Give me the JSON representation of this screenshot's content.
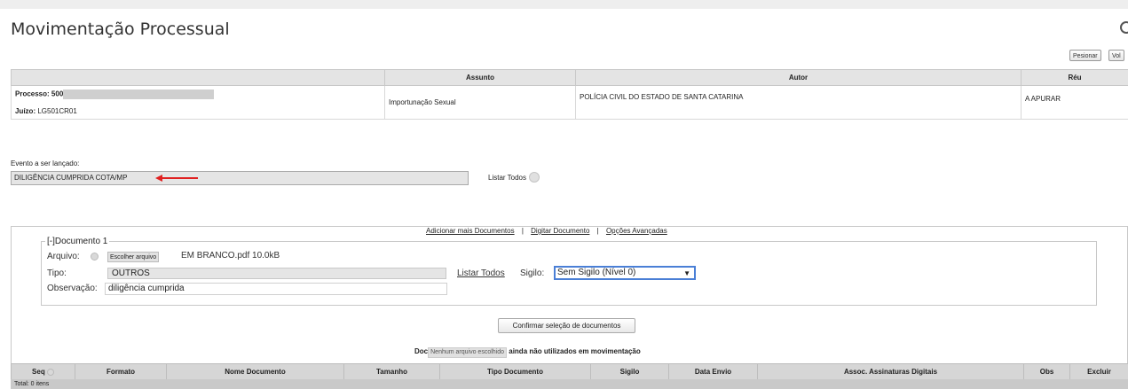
{
  "page_title": "Movimentação Processual",
  "toolbar": {
    "btn1": "Pesionar",
    "btn2": "Vol"
  },
  "processo": {
    "headers": {
      "blank": "",
      "assunto": "Assunto",
      "autor": "Autor",
      "reu": "Réu"
    },
    "processo_label": "Processo:",
    "processo_value": "500",
    "juizo_label": "Juízo:",
    "juizo_value": "LG501CR01",
    "assunto": "Importunação Sexual",
    "autor": "POLÍCIA CIVIL DO ESTADO DE SANTA CATARINA",
    "reu": "A APURAR"
  },
  "evento": {
    "label": "Evento a ser lançado:",
    "value": "DILIGÊNCIA CUMPRIDA COTA/MP",
    "listar_todos": "Listar Todos"
  },
  "doc_links": {
    "adicionar": "Adicionar mais Documentos",
    "digitar": "Digitar Documento",
    "opcoes": "Opções Avançadas",
    "sep": "|"
  },
  "documento": {
    "legend": "[-]Documento 1",
    "arquivo_label": "Arquivo:",
    "escolher_btn": "Escolher arquivo",
    "arquivo_nome": "EM BRANCO.pdf 10.0kB",
    "tipo_label": "Tipo:",
    "tipo_value": "OUTROS",
    "listar_todos": "Listar Todos",
    "sigilo_label": "Sigilo:",
    "sigilo_value": "Sem Sigilo (Nível 0)",
    "observacao_label": "Observação:",
    "observacao_value": "diligência cumprida"
  },
  "confirm_button": "Confirmar seleção de documentos",
  "docs_line": {
    "prefix": "Doc",
    "nofile": "Nenhum arquivo escolhido",
    "suffix": "ainda não utilizados em movimentação"
  },
  "grid": {
    "headers": [
      "Seq",
      "Formato",
      "Nome Documento",
      "Tamanho",
      "Tipo Documento",
      "Sigilo",
      "Data Envio",
      "Assoc. Assinaturas Digitais",
      "Obs",
      "Excluir"
    ],
    "total": "Total: 0 itens"
  }
}
